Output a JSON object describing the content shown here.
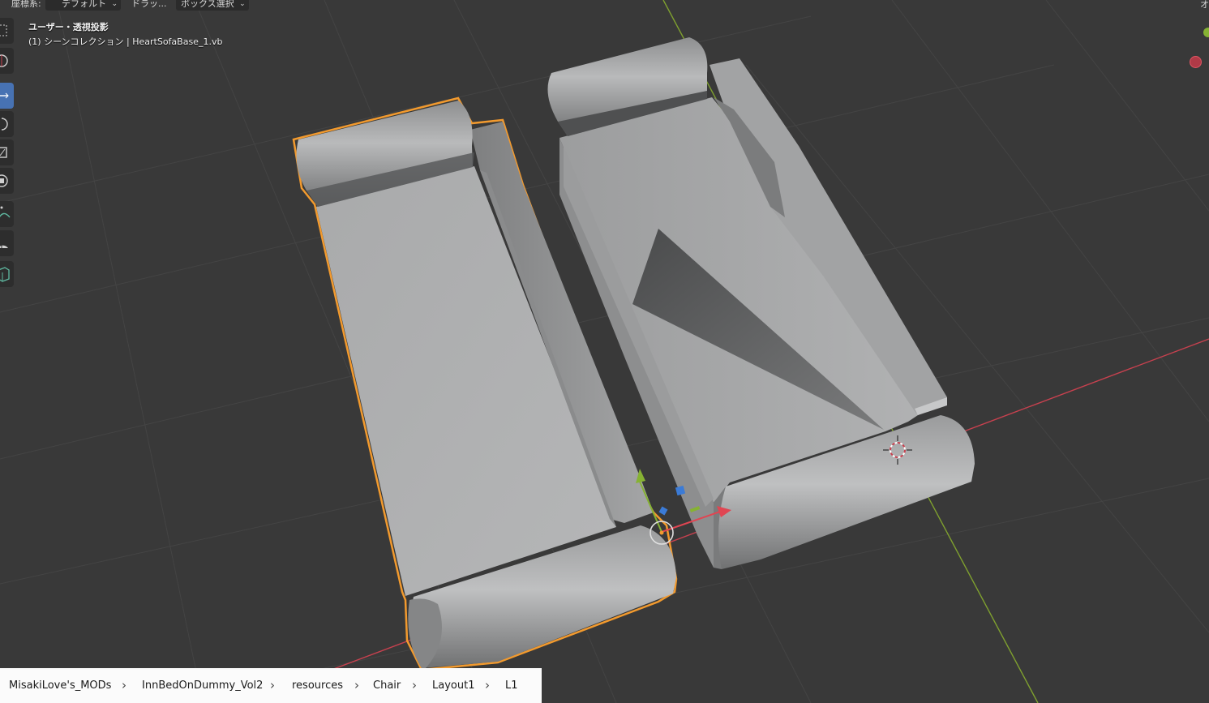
{
  "header": {
    "coord_label": "座標系:",
    "coord_value": "デフォルト",
    "drag_label": "ドラッ...",
    "select_value": "ボックス選択",
    "right_label": "オ"
  },
  "viewport": {
    "view_name": "ユーザー・透視投影",
    "collection_info": "(1) シーンコレクション | HeartSofaBase_1.vb"
  },
  "toolbar": {
    "tools": [
      {
        "icon": "select-box-icon",
        "active": false
      },
      {
        "icon": "cursor-icon",
        "active": false
      },
      {
        "icon": "move-icon",
        "active": true
      },
      {
        "icon": "rotate-icon",
        "active": false
      },
      {
        "icon": "scale-icon",
        "active": false
      },
      {
        "icon": "transform-icon",
        "active": false
      },
      {
        "icon": "annotate-icon",
        "active": false
      },
      {
        "icon": "measure-icon",
        "active": false
      },
      {
        "icon": "add-cube-icon",
        "active": false
      }
    ]
  },
  "colors": {
    "background": "#393939",
    "selection_outline": "#f29a2e",
    "x_axis": "#c8414f",
    "y_axis": "#7fa02f",
    "active_tool": "#4772b3"
  },
  "breadcrumb": {
    "items": [
      "MisakiLove's_MODs",
      "InnBedOnDummy_Vol2",
      "resources",
      "Chair",
      "Layout1",
      "L1"
    ]
  }
}
